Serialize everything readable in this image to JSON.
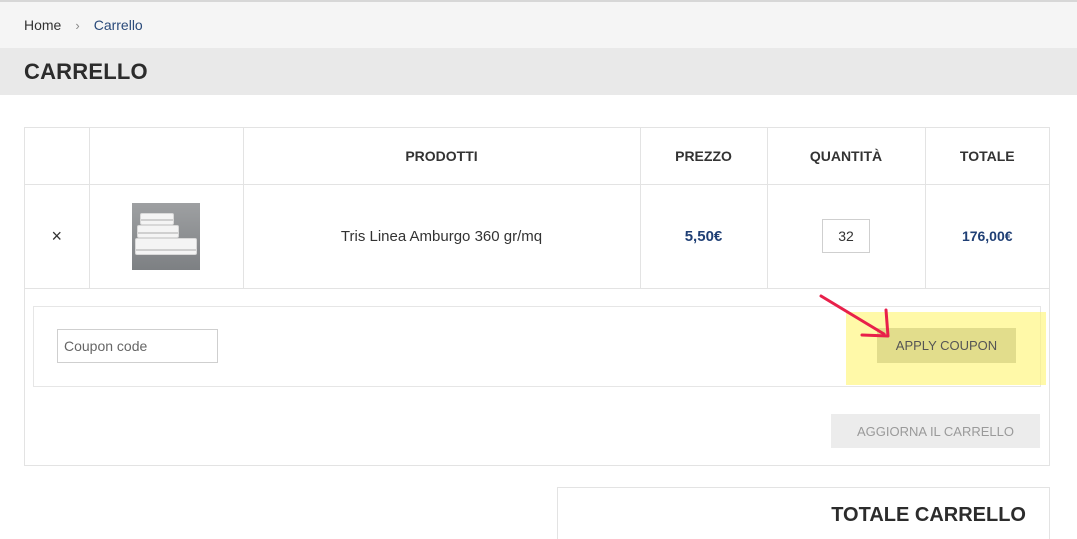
{
  "breadcrumb": {
    "home": "Home",
    "separator": "›",
    "current": "Carrello"
  },
  "page_title": "CARRELLO",
  "table": {
    "headers": [
      "",
      "",
      "PRODOTTI",
      "PREZZO",
      "QUANTITÀ",
      "TOTALE"
    ],
    "rows": [
      {
        "remove": "×",
        "product_name": "Tris Linea Amburgo 360 gr/mq",
        "price": "5,50€",
        "quantity": "32",
        "total": "176,00€"
      }
    ]
  },
  "coupon": {
    "placeholder": "Coupon code",
    "apply_label": "APPLY COUPON"
  },
  "update_label": "AGGIORNA IL CARRELLO",
  "totals": {
    "title": "TOTALE CARRELLO"
  },
  "colors": {
    "accent": "#1f3f75",
    "highlight": "#fff56e",
    "arrow": "#e8204a"
  }
}
